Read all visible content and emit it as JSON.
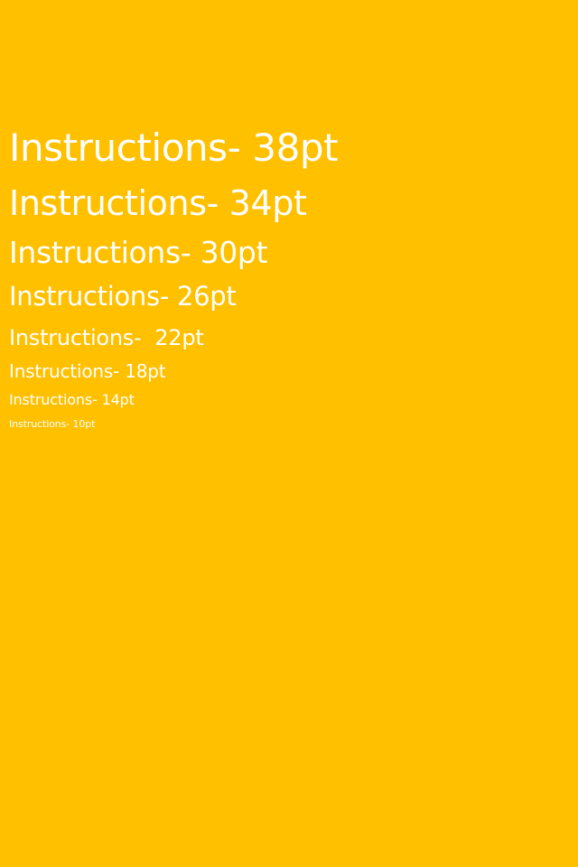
{
  "theme": {
    "background_color": "#FFC000",
    "text_color": "#FFFFFF"
  },
  "font_samples": [
    {
      "label": "Instructions- 38pt"
    },
    {
      "label": "Instructions- 34pt"
    },
    {
      "label": "Instructions- 30pt"
    },
    {
      "label": "Instructions- 26pt"
    },
    {
      "label": "Instructions-  22pt"
    },
    {
      "label": "Instructions- 18pt"
    },
    {
      "label": "Instructions- 14pt"
    },
    {
      "label": "Instructions- 10pt"
    }
  ]
}
